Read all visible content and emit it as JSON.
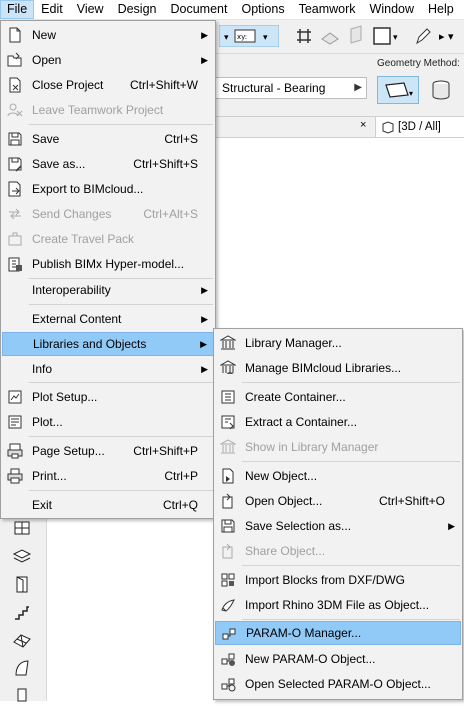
{
  "menubar": {
    "items": [
      "File",
      "Edit",
      "View",
      "Design",
      "Document",
      "Options",
      "Teamwork",
      "Window",
      "Help"
    ]
  },
  "background": {
    "structural_field": "Structural - Bearing",
    "geometry_label": "Geometry Method:",
    "tab_label": "[3D / All]",
    "tab_close": "×"
  },
  "file_menu": {
    "items": [
      {
        "label": "New",
        "shortcut": "",
        "submenu": true,
        "disabled": false,
        "icon": "new-document-icon"
      },
      {
        "label": "Open",
        "shortcut": "",
        "submenu": true,
        "disabled": false,
        "icon": "open-folder-icon"
      },
      {
        "label": "Close Project",
        "shortcut": "Ctrl+Shift+W",
        "submenu": false,
        "disabled": false,
        "icon": "close-project-icon"
      },
      {
        "label": "Leave Teamwork Project",
        "shortcut": "",
        "submenu": false,
        "disabled": true,
        "icon": "leave-teamwork-icon"
      },
      {
        "label": "Save",
        "shortcut": "Ctrl+S",
        "submenu": false,
        "disabled": false,
        "icon": "save-icon"
      },
      {
        "label": "Save as...",
        "shortcut": "Ctrl+Shift+S",
        "submenu": false,
        "disabled": false,
        "icon": "save-as-icon"
      },
      {
        "label": "Export to BIMcloud...",
        "shortcut": "",
        "submenu": false,
        "disabled": false,
        "icon": "export-bimcloud-icon"
      },
      {
        "label": "Send Changes",
        "shortcut": "Ctrl+Alt+S",
        "submenu": false,
        "disabled": true,
        "icon": "send-changes-icon"
      },
      {
        "label": "Create Travel Pack",
        "shortcut": "",
        "submenu": false,
        "disabled": true,
        "icon": "travel-pack-icon"
      },
      {
        "label": "Publish BIMx Hyper-model...",
        "shortcut": "",
        "submenu": false,
        "disabled": false,
        "icon": "bimx-icon"
      },
      {
        "label": "Interoperability",
        "shortcut": "",
        "submenu": true,
        "disabled": false,
        "icon": ""
      },
      {
        "label": "External Content",
        "shortcut": "",
        "submenu": true,
        "disabled": false,
        "icon": ""
      },
      {
        "label": "Libraries and Objects",
        "shortcut": "",
        "submenu": true,
        "disabled": false,
        "icon": ""
      },
      {
        "label": "Info",
        "shortcut": "",
        "submenu": true,
        "disabled": false,
        "icon": ""
      },
      {
        "label": "Plot Setup...",
        "shortcut": "",
        "submenu": false,
        "disabled": false,
        "icon": "plot-setup-icon"
      },
      {
        "label": "Plot...",
        "shortcut": "",
        "submenu": false,
        "disabled": false,
        "icon": "plot-icon"
      },
      {
        "label": "Page Setup...",
        "shortcut": "Ctrl+Shift+P",
        "submenu": false,
        "disabled": false,
        "icon": "page-setup-icon"
      },
      {
        "label": "Print...",
        "shortcut": "Ctrl+P",
        "submenu": false,
        "disabled": false,
        "icon": "print-icon"
      },
      {
        "label": "Exit",
        "shortcut": "Ctrl+Q",
        "submenu": false,
        "disabled": false,
        "icon": ""
      }
    ]
  },
  "libraries_menu": {
    "items": [
      {
        "label": "Library Manager...",
        "shortcut": "",
        "submenu": false,
        "disabled": false,
        "icon": "library-manager-icon"
      },
      {
        "label": "Manage BIMcloud Libraries...",
        "shortcut": "",
        "submenu": false,
        "disabled": false,
        "icon": "bimcloud-library-icon"
      },
      {
        "label": "Create Container...",
        "shortcut": "",
        "submenu": false,
        "disabled": false,
        "icon": "create-container-icon"
      },
      {
        "label": "Extract a Container...",
        "shortcut": "",
        "submenu": false,
        "disabled": false,
        "icon": "extract-container-icon"
      },
      {
        "label": "Show in Library Manager",
        "shortcut": "",
        "submenu": false,
        "disabled": true,
        "icon": "show-library-icon"
      },
      {
        "label": "New Object...",
        "shortcut": "",
        "submenu": false,
        "disabled": false,
        "icon": "new-object-icon"
      },
      {
        "label": "Open Object...",
        "shortcut": "Ctrl+Shift+O",
        "submenu": false,
        "disabled": false,
        "icon": "open-object-icon"
      },
      {
        "label": "Save Selection as...",
        "shortcut": "",
        "submenu": true,
        "disabled": false,
        "icon": "save-selection-icon"
      },
      {
        "label": "Share Object...",
        "shortcut": "",
        "submenu": false,
        "disabled": true,
        "icon": "share-object-icon"
      },
      {
        "label": "Import Blocks from DXF/DWG",
        "shortcut": "",
        "submenu": false,
        "disabled": false,
        "icon": "import-dxf-icon"
      },
      {
        "label": "Import Rhino 3DM File as Object...",
        "shortcut": "",
        "submenu": false,
        "disabled": false,
        "icon": "import-rhino-icon"
      },
      {
        "label": "PARAM-O Manager...",
        "shortcut": "",
        "submenu": false,
        "disabled": false,
        "icon": "param-o-manager-icon"
      },
      {
        "label": "New PARAM-O Object...",
        "shortcut": "",
        "submenu": false,
        "disabled": false,
        "icon": "new-param-o-icon"
      },
      {
        "label": "Open Selected PARAM-O Object...",
        "shortcut": "",
        "submenu": false,
        "disabled": false,
        "icon": "open-param-o-icon"
      }
    ]
  },
  "colors": {
    "highlight": "#91c9f7",
    "menu_bg": "#f2f2f2",
    "disabled_text": "#a0a0a0"
  }
}
